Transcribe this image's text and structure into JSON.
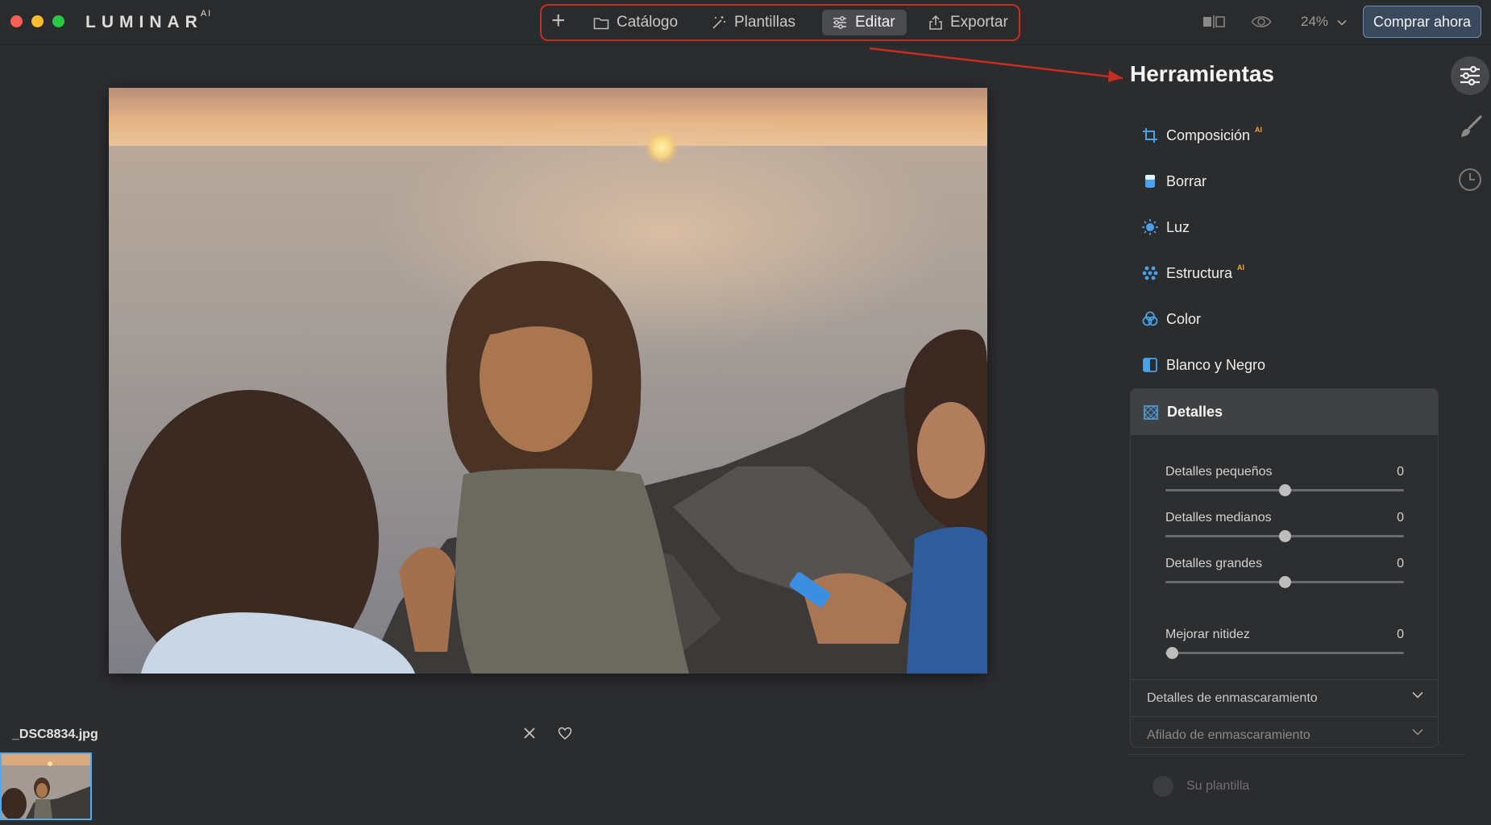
{
  "app": {
    "brand": "LUMINAR",
    "brand_suffix": "AI"
  },
  "nav": {
    "add_label": "+",
    "catalog_label": "Catálogo",
    "templates_label": "Plantillas",
    "edit_label": "Editar",
    "export_label": "Exportar",
    "active": "Editar"
  },
  "toolbar": {
    "zoom": "24%",
    "buy_label": "Comprar ahora"
  },
  "image": {
    "filename": "_DSC8834.jpg"
  },
  "panel": {
    "title": "Herramientas",
    "tools": [
      {
        "label": "Composición",
        "ai": "AI",
        "icon": "crop-icon"
      },
      {
        "label": "Borrar",
        "ai": "",
        "icon": "eraser-icon"
      },
      {
        "label": "Luz",
        "ai": "",
        "icon": "sun-icon"
      },
      {
        "label": "Estructura",
        "ai": "AI",
        "icon": "structure-icon"
      },
      {
        "label": "Color",
        "ai": "",
        "icon": "color-circles-icon"
      },
      {
        "label": "Blanco y Negro",
        "ai": "",
        "icon": "half-square-icon"
      }
    ],
    "details": {
      "title": "Detalles",
      "sliders": [
        {
          "label": "Detalles pequeños",
          "value": "0",
          "position": 0.5
        },
        {
          "label": "Detalles medianos",
          "value": "0",
          "position": 0.5
        },
        {
          "label": "Detalles grandes",
          "value": "0",
          "position": 0.5
        },
        {
          "label": "Mejorar nitidez",
          "value": "0",
          "position": 0.0
        }
      ],
      "sections": [
        {
          "label": "Detalles de enmascaramiento"
        },
        {
          "label": "Afilado de enmascaramiento"
        }
      ]
    },
    "template_label": "Su plantilla"
  },
  "colors": {
    "accent_blue": "#4aa3ea",
    "annotation_red": "#c72d22",
    "ai_badge": "#f0a23a"
  }
}
